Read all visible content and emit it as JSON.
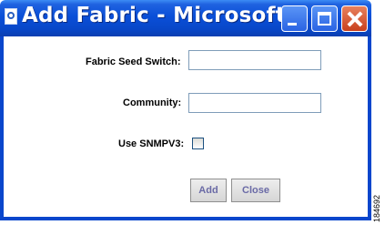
{
  "window": {
    "title": "Add Fabric - Microsoft I..."
  },
  "form": {
    "seed_switch_label": "Fabric Seed Switch:",
    "seed_switch_value": "",
    "community_label": "Community:",
    "community_value": "",
    "snmpv3_label": "Use SNMPV3:",
    "snmpv3_checked": false
  },
  "buttons": {
    "add_label": "Add",
    "close_label": "Close"
  },
  "figure_id": "184692"
}
